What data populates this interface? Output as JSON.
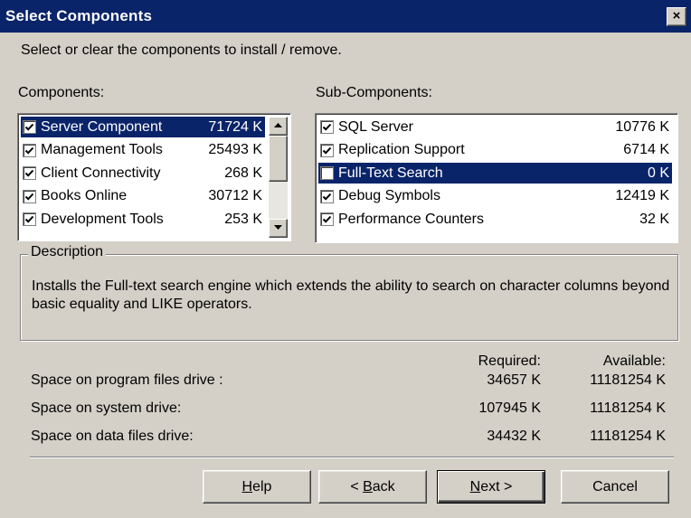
{
  "window": {
    "title": "Select Components",
    "close_glyph": "×"
  },
  "instruction": "Select or clear the components to install / remove.",
  "components": {
    "label": "Components:",
    "items": [
      {
        "name": "Server Component",
        "size": "71724 K",
        "checked": true,
        "selected": true
      },
      {
        "name": "Management Tools",
        "size": "25493 K",
        "checked": true,
        "selected": false
      },
      {
        "name": "Client Connectivity",
        "size": "268 K",
        "checked": true,
        "selected": false
      },
      {
        "name": "Books Online",
        "size": "30712 K",
        "checked": true,
        "selected": false
      },
      {
        "name": "Development Tools",
        "size": "253 K",
        "checked": true,
        "selected": false
      }
    ]
  },
  "subcomponents": {
    "label": "Sub-Components:",
    "items": [
      {
        "name": "SQL Server",
        "size": "10776 K",
        "checked": true,
        "selected": false
      },
      {
        "name": "Replication Support",
        "size": "6714 K",
        "checked": true,
        "selected": false
      },
      {
        "name": "Full-Text Search",
        "size": "0 K",
        "checked": false,
        "selected": true
      },
      {
        "name": "Debug Symbols",
        "size": "12419 K",
        "checked": true,
        "selected": false
      },
      {
        "name": "Performance Counters",
        "size": "32 K",
        "checked": true,
        "selected": false
      }
    ]
  },
  "description": {
    "title": "Description",
    "text": "Installs the Full-text search engine which extends the ability to search on character columns beyond basic equality and LIKE operators."
  },
  "space": {
    "required_header": "Required:",
    "available_header": "Available:",
    "rows": [
      {
        "label": "Space on program files drive :",
        "required": "34657 K",
        "available": "11181254 K"
      },
      {
        "label": "Space on system drive:",
        "required": "107945 K",
        "available": "11181254 K"
      },
      {
        "label": "Space on data files drive:",
        "required": "34432 K",
        "available": "11181254 K"
      }
    ]
  },
  "buttons": {
    "help": {
      "mnemonic": "H",
      "rest": "elp"
    },
    "back": {
      "prefix": "< ",
      "mnemonic": "B",
      "rest": "ack"
    },
    "next": {
      "mnemonic": "N",
      "rest": "ext >"
    },
    "cancel": "Cancel"
  },
  "colors": {
    "face": "#d4d0c8",
    "title": "#0a246a",
    "selection": "#0a246a"
  },
  "icons": {
    "check": "check-icon",
    "scroll_up": "arrow-up-icon",
    "scroll_down": "arrow-down-icon",
    "close": "close-icon"
  }
}
